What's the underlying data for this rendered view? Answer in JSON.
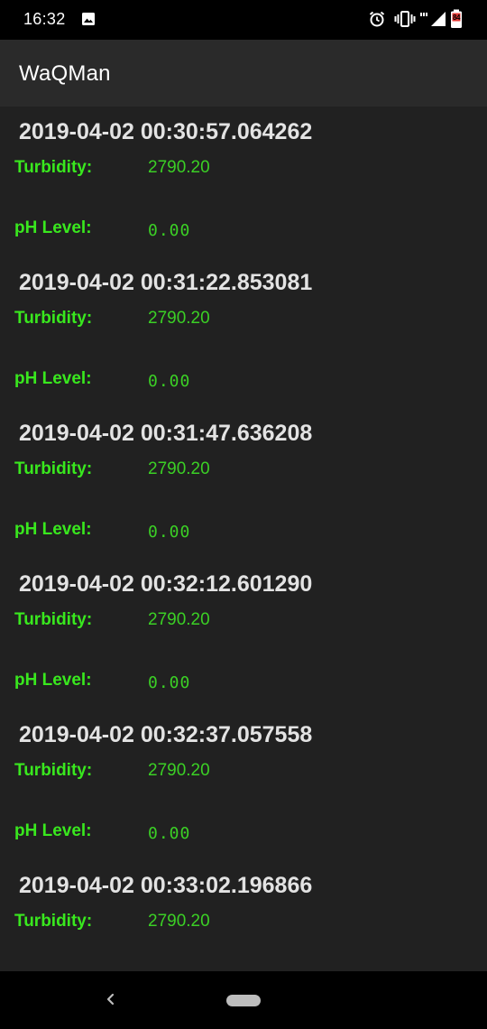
{
  "status_bar": {
    "time": "16:32",
    "battery_level": "84",
    "icons": [
      "image-icon",
      "alarm-icon",
      "vibrate-icon",
      "signal-4g-icon",
      "signal-icon",
      "battery-icon"
    ]
  },
  "app_bar": {
    "title": "WaQMan"
  },
  "colors": {
    "background": "#212121",
    "app_bar": "#2a2a2a",
    "label_green": "#39e81e",
    "value_green": "#3bd025",
    "timestamp": "#e3e3e3"
  },
  "readings": [
    {
      "timestamp": "2019-04-02 00:30:57.064262",
      "turbidity_label": "Turbidity:",
      "turbidity_value": "2790.20",
      "ph_label": "pH Level:",
      "ph_value": "0.00"
    },
    {
      "timestamp": "2019-04-02 00:31:22.853081",
      "turbidity_label": "Turbidity:",
      "turbidity_value": "2790.20",
      "ph_label": "pH Level:",
      "ph_value": "0.00"
    },
    {
      "timestamp": "2019-04-02 00:31:47.636208",
      "turbidity_label": "Turbidity:",
      "turbidity_value": "2790.20",
      "ph_label": "pH Level:",
      "ph_value": "0.00"
    },
    {
      "timestamp": "2019-04-02 00:32:12.601290",
      "turbidity_label": "Turbidity:",
      "turbidity_value": "2790.20",
      "ph_label": "pH Level:",
      "ph_value": "0.00"
    },
    {
      "timestamp": "2019-04-02 00:32:37.057558",
      "turbidity_label": "Turbidity:",
      "turbidity_value": "2790.20",
      "ph_label": "pH Level:",
      "ph_value": "0.00"
    },
    {
      "timestamp": "2019-04-02 00:33:02.196866",
      "turbidity_label": "Turbidity:",
      "turbidity_value": "2790.20"
    }
  ],
  "nav_bar": {
    "icons": [
      "back-icon",
      "home-pill-icon"
    ]
  }
}
